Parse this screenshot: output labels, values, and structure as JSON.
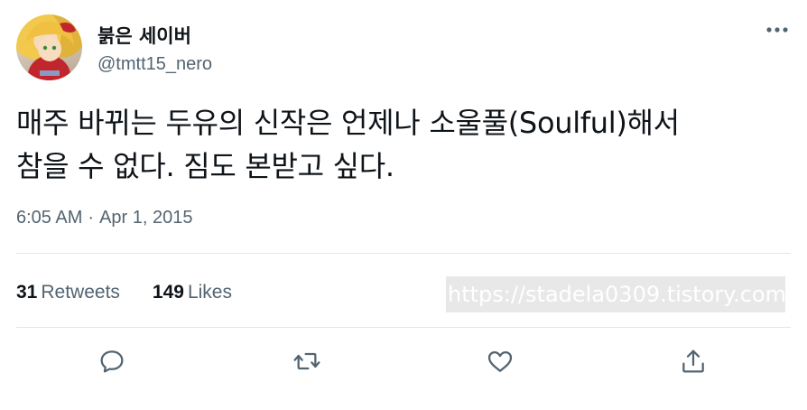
{
  "user": {
    "display_name": "붉은 세이버",
    "handle": "@tmtt15_nero",
    "avatar_icon": "profile-avatar"
  },
  "tweet": {
    "text_line1": "매주 바뀌는 두유의 신작은 언제나 소울풀(Soulful)해서",
    "text_line2": "참을 수 없다. 짐도 본받고 싶다.",
    "time": "6:05 AM",
    "separator": "·",
    "date": "Apr 1, 2015"
  },
  "stats": {
    "retweets_count": "31",
    "retweets_label": "Retweets",
    "likes_count": "149",
    "likes_label": "Likes"
  },
  "watermark": "https://stadela0309.tistory.com",
  "actions": {
    "reply_icon": "speech-bubble-icon",
    "retweet_icon": "retweet-arrows-icon",
    "like_icon": "heart-icon",
    "share_icon": "share-upload-icon",
    "more_icon": "ellipsis-icon"
  },
  "colors": {
    "text_primary": "#0f1419",
    "text_secondary": "#536471",
    "divider": "#e1e6ea"
  }
}
